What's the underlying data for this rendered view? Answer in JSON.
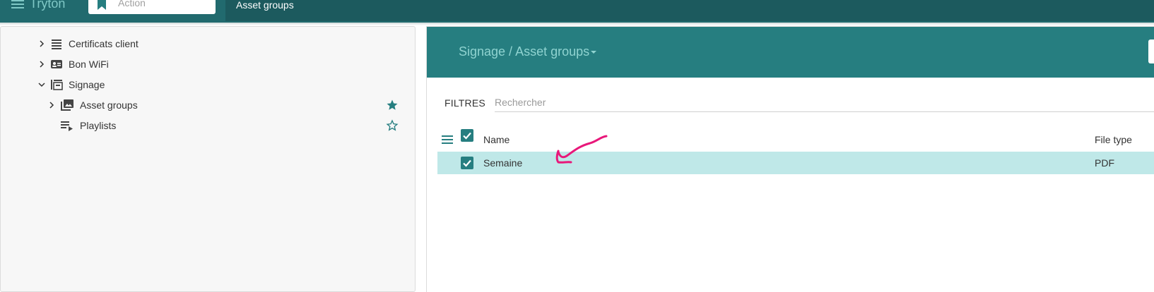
{
  "app": {
    "title": "Tryton"
  },
  "action": {
    "placeholder": "Action"
  },
  "tab": {
    "label": "Asset groups"
  },
  "sidebar": {
    "items": [
      {
        "label": "Certificats client",
        "icon": "list-icon",
        "expanded": false,
        "favorite": null
      },
      {
        "label": "Bon WiFi",
        "icon": "badge-icon",
        "expanded": false,
        "favorite": null
      },
      {
        "label": "Signage",
        "icon": "signage-icon",
        "expanded": true,
        "favorite": null
      },
      {
        "label": "Asset groups",
        "icon": "photo-library-icon",
        "expanded": false,
        "favorite": true
      },
      {
        "label": "Playlists",
        "icon": "playlist-icon",
        "expanded": null,
        "favorite": false
      }
    ]
  },
  "main": {
    "breadcrumb": "Signage / Asset groups",
    "filters_label": "FILTRES",
    "search_placeholder": "Rechercher",
    "columns": {
      "name": "Name",
      "file_type": "File type"
    },
    "rows": [
      {
        "name": "Semaine",
        "file_type": "PDF",
        "selected": true
      }
    ]
  },
  "colors": {
    "topbar": "#216a6e",
    "header": "#267e80",
    "accent": "#267e80",
    "selected_row": "#bfe8e8",
    "annotation": "#e8187a"
  }
}
